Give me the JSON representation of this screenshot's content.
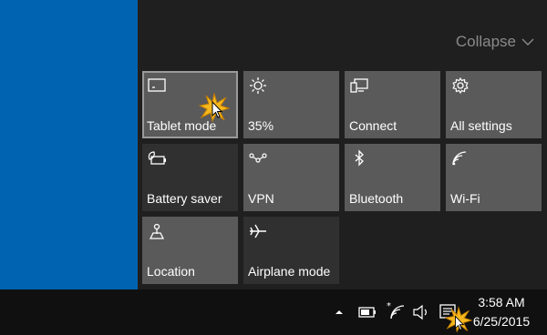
{
  "action_center": {
    "collapse_label": "Collapse",
    "tiles": [
      {
        "label": "Tablet mode",
        "icon": "tablet-mode-icon",
        "state": "on"
      },
      {
        "label": "35%",
        "icon": "brightness-icon",
        "state": "on"
      },
      {
        "label": "Connect",
        "icon": "connect-icon",
        "state": "on"
      },
      {
        "label": "All settings",
        "icon": "gear-icon",
        "state": "on"
      },
      {
        "label": "Battery saver",
        "icon": "battery-saver-icon",
        "state": "off"
      },
      {
        "label": "VPN",
        "icon": "vpn-icon",
        "state": "on"
      },
      {
        "label": "Bluetooth",
        "icon": "bluetooth-icon",
        "state": "on"
      },
      {
        "label": "Wi-Fi",
        "icon": "wifi-icon",
        "state": "on"
      },
      {
        "label": "Location",
        "icon": "location-icon",
        "state": "on"
      },
      {
        "label": "Airplane mode",
        "icon": "airplane-icon",
        "state": "off"
      }
    ]
  },
  "taskbar": {
    "time": "3:58 AM",
    "date": "6/25/2015",
    "tray_icons": [
      "chevron-up-icon",
      "battery-icon",
      "wifi-icon",
      "volume-icon",
      "action-center-icon"
    ]
  },
  "colors": {
    "desktop": "#0063b1",
    "panel": "#1f1f1f",
    "tile_on": "#5a5a5a",
    "tile_off": "#303030",
    "taskbar": "#101010"
  }
}
